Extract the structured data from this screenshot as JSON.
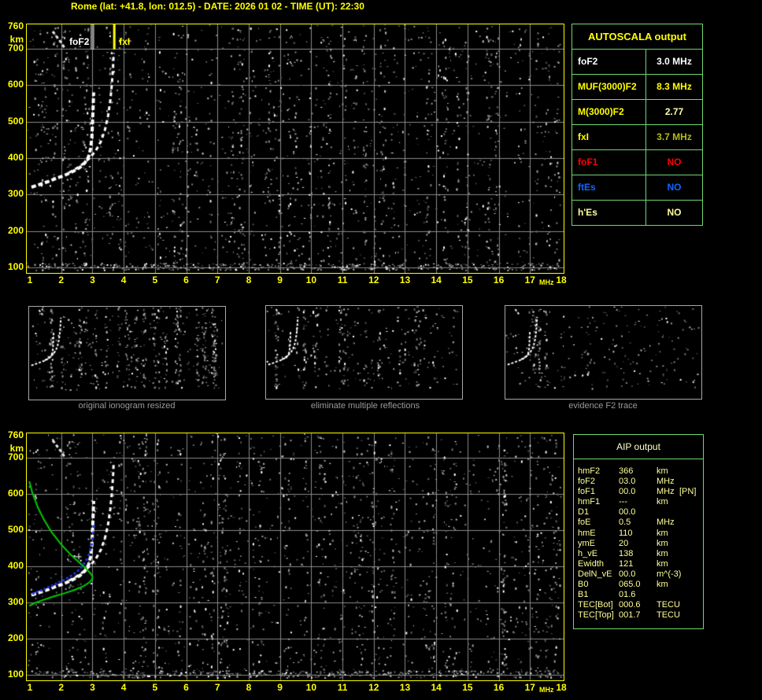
{
  "header": {
    "title": "Rome (lat: +41.8, lon: 012.5) - DATE: 2026 01 02 - TIME (UT): 22:30"
  },
  "colors": {
    "axis_yellow": "#ffff00",
    "grid_gray": "#8a8a8a",
    "plot_border": "#ffff00",
    "table_border_green": "#70d870",
    "pale_yellow": "#ffff99",
    "header_pale": "#ffffcc",
    "olive_yellow": "#b8b81a",
    "red": "#ff0000",
    "blue": "#1166ff",
    "white": "#ffffff",
    "green_profile": "#00cc00",
    "blue_restored": "#2233dd",
    "caption_gray": "#9a9a9a",
    "thumb_border": "#a8a8a8"
  },
  "axes": {
    "x_ticks": [
      1,
      2,
      3,
      4,
      5,
      6,
      7,
      8,
      9,
      10,
      11,
      12,
      13,
      14,
      15,
      16,
      17,
      18
    ],
    "x_unit": "MHz",
    "y_ticks": [
      760,
      700,
      600,
      500,
      400,
      300,
      200,
      100
    ],
    "y_unit": "km",
    "x_range_mhz": [
      1,
      18
    ],
    "y_range_km": [
      100,
      760
    ]
  },
  "autoscala_table": {
    "title": "AUTOSCALA output",
    "rows": [
      {
        "label": "foF2",
        "value": "3.0 MHz",
        "label_color": "#ffffff",
        "value_color": "#ffffff"
      },
      {
        "label": "MUF(3000)F2",
        "value": "8.3 MHz",
        "label_color": "#ffff00",
        "value_color": "#ffff00"
      },
      {
        "label": "M(3000)F2",
        "value": "2.77",
        "label_color": "#ffff00",
        "value_color": "#ffffa8"
      },
      {
        "label": "fxI",
        "value": "3.7 MHz",
        "label_color": "#ffff00",
        "value_color": "#b8b81a"
      },
      {
        "label": "foF1",
        "value": "NO",
        "label_color": "#ff0000",
        "value_color": "#ff0000"
      },
      {
        "label": "ftEs",
        "value": "NO",
        "label_color": "#1166ff",
        "value_color": "#1166ff"
      },
      {
        "label": "h'Es",
        "value": "NO",
        "label_color": "#ffff99",
        "value_color": "#ffff99"
      }
    ]
  },
  "thumbnails": [
    {
      "caption": "original ionogram resized"
    },
    {
      "caption": "eliminate multiple reflections"
    },
    {
      "caption": "evidence F2 trace"
    }
  ],
  "aip_table": {
    "title": "AIP output",
    "rows": [
      {
        "name": "hmF2",
        "value": "366",
        "unit": "km",
        "extra": ""
      },
      {
        "name": "foF2",
        "value": "03.0",
        "unit": "MHz",
        "extra": ""
      },
      {
        "name": "foF1",
        "value": "00.0",
        "unit": "MHz",
        "extra": "[PN]"
      },
      {
        "name": "hmF1",
        "value": "---",
        "unit": "km",
        "extra": ""
      },
      {
        "name": "D1",
        "value": "00.0",
        "unit": "",
        "extra": ""
      },
      {
        "name": "foE",
        "value": "0.5",
        "unit": "MHz",
        "extra": ""
      },
      {
        "name": "hmE",
        "value": "110",
        "unit": "km",
        "extra": ""
      },
      {
        "name": "ymE",
        "value": "20",
        "unit": "km",
        "extra": ""
      },
      {
        "name": "h_vE",
        "value": "138",
        "unit": "km",
        "extra": ""
      },
      {
        "name": "Ewidth",
        "value": "121",
        "unit": "km",
        "extra": ""
      },
      {
        "name": "DelN_vE",
        "value": "00.0",
        "unit": "m^(-3)",
        "extra": ""
      },
      {
        "name": "B0",
        "value": "065.0",
        "unit": "km",
        "extra": ""
      },
      {
        "name": "B1",
        "value": "01.6",
        "unit": "",
        "extra": ""
      },
      {
        "name": "TEC[Bot]",
        "value": "000.6",
        "unit": "TECU",
        "extra": ""
      },
      {
        "name": "TEC[Top]",
        "value": "001.7",
        "unit": "TECU",
        "extra": ""
      }
    ]
  },
  "chart_data": [
    {
      "type": "scatter",
      "title": "scaled ionogram with AUTOSCALA markers",
      "xlabel": "MHz",
      "ylabel": "km",
      "xlim": [
        1,
        18
      ],
      "ylim": [
        100,
        760
      ],
      "grid": {
        "x_step_mhz": 1,
        "y_step_km": 100,
        "on": true
      },
      "series": [
        {
          "name": "F2-ordinary-echo-trace",
          "color": "#ffffff",
          "width": 4,
          "dash": [
            6,
            3
          ],
          "points": [
            [
              1.05,
              320
            ],
            [
              1.3,
              327
            ],
            [
              1.6,
              336
            ],
            [
              1.9,
              346
            ],
            [
              2.15,
              354
            ],
            [
              2.4,
              364
            ],
            [
              2.6,
              374
            ],
            [
              2.75,
              386
            ],
            [
              2.87,
              402
            ],
            [
              2.94,
              425
            ],
            [
              2.98,
              455
            ],
            [
              3.0,
              492
            ],
            [
              3.02,
              535
            ],
            [
              3.04,
              580
            ]
          ]
        },
        {
          "name": "F2-extraordinary-echo-trace",
          "color": "#ffffff",
          "width": 3,
          "dash": [
            5,
            4
          ],
          "points": [
            [
              2.25,
              360
            ],
            [
              2.5,
              372
            ],
            [
              2.7,
              384
            ],
            [
              2.9,
              399
            ],
            [
              3.1,
              419
            ],
            [
              3.27,
              445
            ],
            [
              3.4,
              477
            ],
            [
              3.5,
              515
            ],
            [
              3.57,
              556
            ],
            [
              3.62,
              600
            ],
            [
              3.66,
              648
            ],
            [
              3.68,
              688
            ]
          ]
        },
        {
          "name": "topside-streak",
          "color": "#e8e8e8",
          "width": 3,
          "dash": [
            4,
            3
          ],
          "points": [
            [
              1.73,
              747
            ],
            [
              1.88,
              730
            ],
            [
              2.02,
              714
            ],
            [
              2.12,
              700
            ]
          ]
        }
      ],
      "markers": [
        {
          "label": "foF2",
          "x_mhz": 3.0,
          "color": "#ffffff",
          "style": "double-line",
          "label_side": "left"
        },
        {
          "label": "fxI",
          "x_mhz": 3.7,
          "color": "#ffff00",
          "style": "thick-line",
          "label_side": "right"
        }
      ]
    },
    {
      "type": "scatter",
      "title": "ionogram with AIP inversion output",
      "xlabel": "MHz",
      "ylabel": "km",
      "xlim": [
        1,
        18
      ],
      "ylim": [
        100,
        760
      ],
      "note": "contains the same F2 echo traces as the top panel",
      "series": [
        {
          "name": "electron-density-profile",
          "color": "#00cc00",
          "width": 2,
          "dash": [],
          "points": [
            [
              0.98,
              634
            ],
            [
              1.08,
              602
            ],
            [
              1.25,
              563
            ],
            [
              1.45,
              528
            ],
            [
              1.7,
              493
            ],
            [
              2.0,
              460
            ],
            [
              2.3,
              432
            ],
            [
              2.58,
              410
            ],
            [
              2.8,
              393
            ],
            [
              2.93,
              381
            ],
            [
              3.0,
              372
            ],
            [
              2.99,
              364
            ],
            [
              2.9,
              355
            ],
            [
              2.72,
              345
            ],
            [
              2.45,
              335
            ],
            [
              2.1,
              325
            ],
            [
              1.75,
              316
            ],
            [
              1.4,
              306
            ],
            [
              1.12,
              297
            ],
            [
              0.98,
              290
            ]
          ]
        },
        {
          "name": "restored-ordinary-trace",
          "color": "#2233dd",
          "style": "squares",
          "points": [
            [
              1.1,
              326
            ],
            [
              1.22,
              330
            ],
            [
              1.34,
              334
            ],
            [
              1.46,
              338
            ],
            [
              1.58,
              343
            ],
            [
              1.7,
              347
            ],
            [
              1.82,
              352
            ],
            [
              1.94,
              357
            ],
            [
              2.06,
              362
            ],
            [
              2.18,
              368
            ],
            [
              2.3,
              374
            ],
            [
              2.42,
              381
            ],
            [
              2.53,
              389
            ],
            [
              2.63,
              398
            ],
            [
              2.72,
              408
            ],
            [
              2.8,
              419
            ],
            [
              2.87,
              432
            ],
            [
              2.92,
              446
            ],
            [
              2.96,
              461
            ],
            [
              2.99,
              477
            ],
            [
              3.02,
              494
            ],
            [
              3.04,
              511
            ]
          ]
        },
        {
          "name": "fit-cross-marker",
          "color": "#ffffff",
          "style": "cross",
          "points": [
            [
              2.55,
              427
            ]
          ]
        }
      ]
    }
  ]
}
